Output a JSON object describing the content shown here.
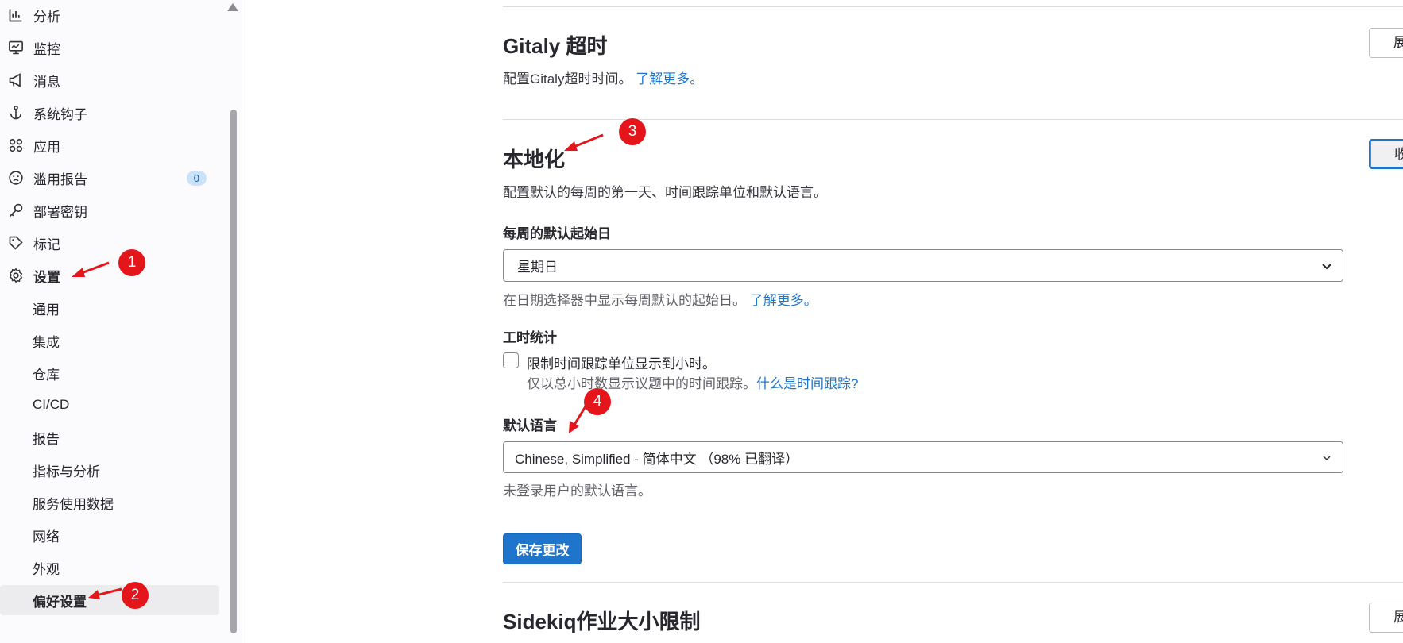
{
  "sidebar": {
    "items": [
      {
        "label": "分析",
        "icon": "chart-icon"
      },
      {
        "label": "监控",
        "icon": "monitor-icon"
      },
      {
        "label": "消息",
        "icon": "bullhorn-icon"
      },
      {
        "label": "系统钩子",
        "icon": "anchor-icon"
      },
      {
        "label": "应用",
        "icon": "apps-icon"
      },
      {
        "label": "滥用报告",
        "icon": "sad-face-icon",
        "badge": "0"
      },
      {
        "label": "部署密钥",
        "icon": "key-icon"
      },
      {
        "label": "标记",
        "icon": "label-icon"
      },
      {
        "label": "设置",
        "icon": "gear-icon"
      }
    ],
    "settings_subitems": [
      "通用",
      "集成",
      "仓库",
      "CI/CD",
      "报告",
      "指标与分析",
      "服务使用数据",
      "网络",
      "外观",
      "偏好设置"
    ],
    "active_subitem": "偏好设置"
  },
  "sections": {
    "gitaly": {
      "title": "Gitaly 超时",
      "desc": "配置Gitaly超时时间。",
      "link": "了解更多。",
      "toggle_label": "展开"
    },
    "localization": {
      "title": "本地化",
      "desc": "配置默认的每周的第一天、时间跟踪单位和默认语言。",
      "toggle_label": "收起",
      "first_day": {
        "label": "每周的默认起始日",
        "value": "星期日",
        "help": "在日期选择器中显示每周默认的起始日。",
        "help_link": "了解更多。"
      },
      "time_tracking": {
        "label": "工时统计",
        "checkbox_label": "限制时间跟踪单位显示到小时。",
        "checked": false,
        "help": "仅以总小时数显示议题中的时间跟踪。",
        "help_link": "什么是时间跟踪?"
      },
      "language": {
        "label": "默认语言",
        "value": "Chinese, Simplified - 简体中文 （98% 已翻译）",
        "help": "未登录用户的默认语言。"
      },
      "save_label": "保存更改"
    },
    "sidekiq": {
      "title": "Sidekiq作业大小限制",
      "toggle_label": "展开"
    }
  },
  "annotations": {
    "markers": [
      "1",
      "2",
      "3",
      "4"
    ],
    "color": "#e4161b"
  },
  "colors": {
    "primary": "#1f75cb",
    "link": "#1f75cb",
    "badge_bg": "#cbe2f9"
  }
}
